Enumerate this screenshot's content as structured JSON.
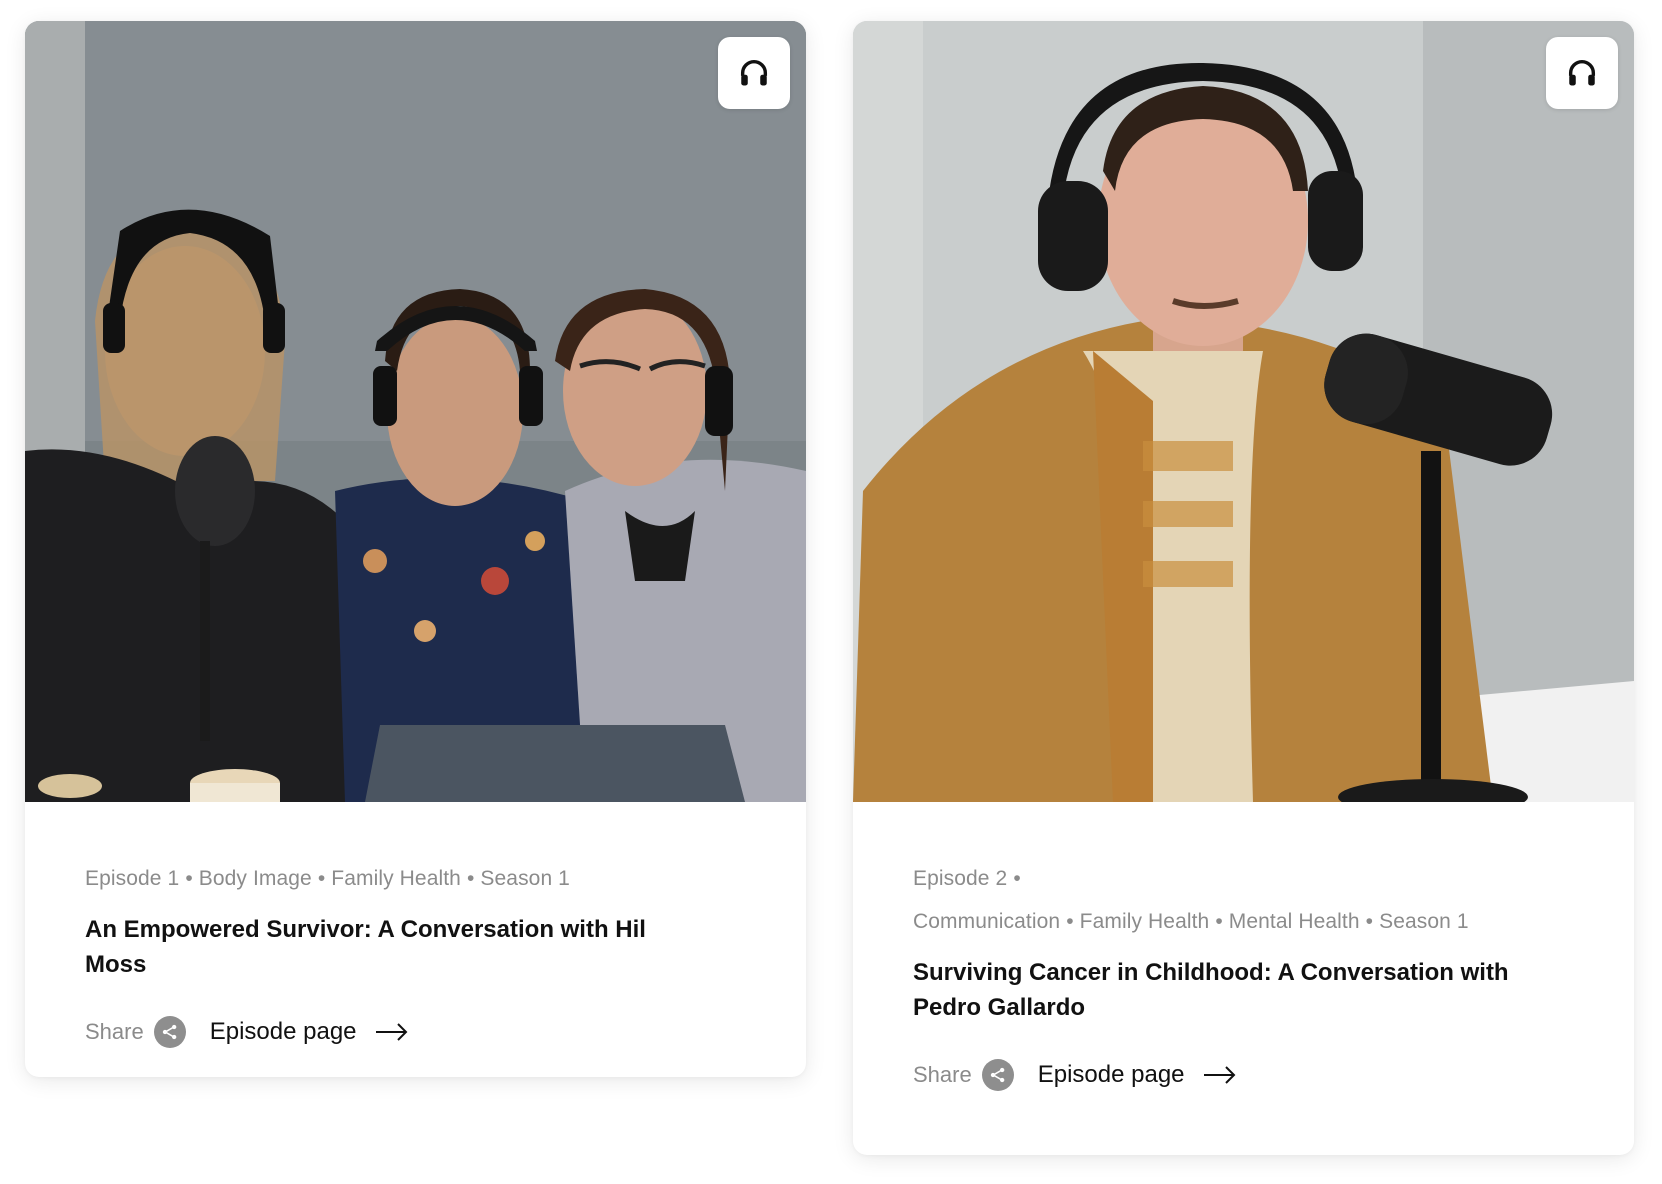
{
  "cards": [
    {
      "meta_line1": [
        "Episode 1",
        "Body Image",
        "Family Health",
        "Season 1"
      ],
      "meta_line2": [],
      "title": "An Empowered Survivor: A Conversation with Hil Moss",
      "share_label": "Share",
      "episode_link": "Episode page",
      "image_icon": "headphones-icon"
    },
    {
      "meta_line1": [
        "Episode 2"
      ],
      "meta_line2": [
        "Communication",
        "Family Health",
        "Mental Health",
        "Season 1"
      ],
      "title": "Surviving Cancer in Childhood: A Conversation with Pedro Gallardo",
      "share_label": "Share",
      "episode_link": "Episode page",
      "image_icon": "headphones-icon"
    }
  ],
  "colors": {
    "meta_text": "#8b8b8b",
    "title_text": "#111111",
    "share_icon_bg": "#8e8e8e"
  }
}
